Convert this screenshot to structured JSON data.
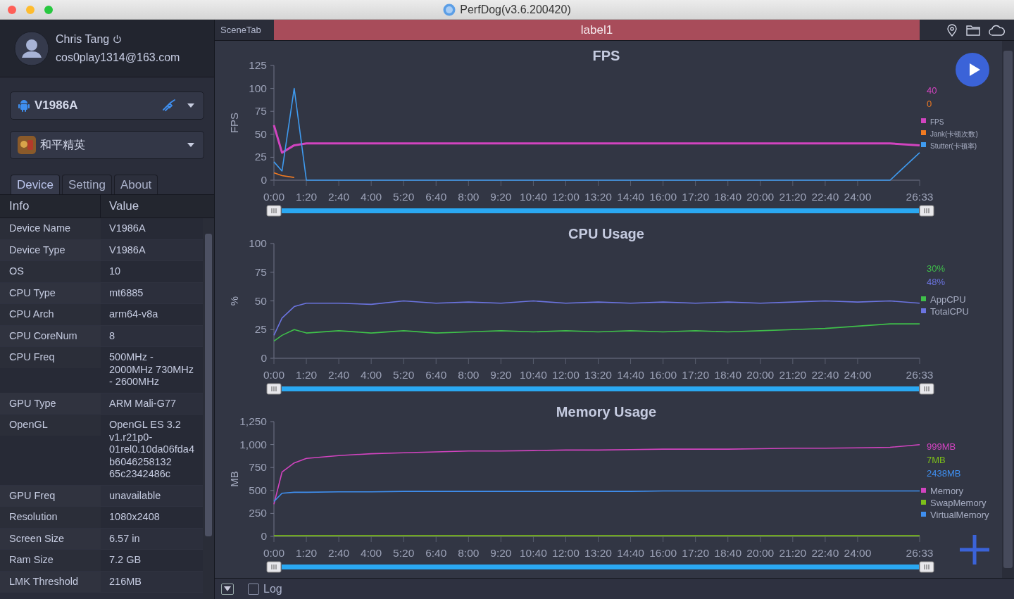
{
  "window": {
    "title": "PerfDog(v3.6.200420)"
  },
  "user": {
    "name": "Chris Tang",
    "email": "cos0play1314@163.com"
  },
  "device_select": {
    "value": "V1986A"
  },
  "app_select": {
    "value": "和平精英"
  },
  "tabs": [
    {
      "label": "Device",
      "selected": true
    },
    {
      "label": "Setting",
      "selected": false
    },
    {
      "label": "About",
      "selected": false
    }
  ],
  "info_table": {
    "columns": [
      "Info",
      "Value"
    ],
    "rows": [
      {
        "label": "Device Name",
        "value": "V1986A"
      },
      {
        "label": "Device Type",
        "value": "V1986A"
      },
      {
        "label": "OS",
        "value": "10"
      },
      {
        "label": "CPU Type",
        "value": "mt6885"
      },
      {
        "label": "CPU Arch",
        "value": "arm64-v8a"
      },
      {
        "label": "CPU CoreNum",
        "value": "8"
      },
      {
        "label": "CPU Freq",
        "value": "500MHz - 2000MHz 730MHz - 2600MHz"
      },
      {
        "label": "GPU Type",
        "value": "ARM Mali-G77"
      },
      {
        "label": "OpenGL",
        "value": "OpenGL ES 3.2 v1.r21p0-01rel0.10da06fda4b6046258132 65c2342486c"
      },
      {
        "label": "GPU Freq",
        "value": "unavailable"
      },
      {
        "label": "Resolution",
        "value": "1080x2408"
      },
      {
        "label": "Screen Size",
        "value": "6.57 in"
      },
      {
        "label": "Ram Size",
        "value": "7.2 GB"
      },
      {
        "label": "LMK Threshold",
        "value": "216MB"
      }
    ]
  },
  "scene_tab": {
    "label": "SceneTab",
    "scene": "label1"
  },
  "charts": [
    {
      "readings": [
        {
          "text": "40",
          "color": "#d244c0"
        },
        {
          "text": "0",
          "color": "#f07a22"
        }
      ],
      "chart_data": {
        "type": "line",
        "title": "FPS",
        "ylabel": "FPS",
        "x": [
          0,
          20,
          50,
          80,
          160,
          240,
          320,
          400,
          480,
          560,
          640,
          720,
          800,
          880,
          960,
          1040,
          1120,
          1200,
          1280,
          1360,
          1440,
          1520,
          1593
        ],
        "series": [
          {
            "name": "FPS",
            "color": "#d244c0",
            "values": [
              60,
              30,
              38,
              40,
              40,
              40,
              40,
              40,
              40,
              40,
              40,
              40,
              40,
              40,
              40,
              40,
              40,
              40,
              40,
              40,
              40,
              40,
              38
            ]
          },
          {
            "name": "Jank(卡顿次数)",
            "color": "#f07a22",
            "values": [
              8,
              5,
              3,
              null,
              null,
              null,
              null,
              null,
              null,
              null,
              null,
              null,
              null,
              null,
              null,
              null,
              null,
              null,
              null,
              null,
              null,
              null,
              null
            ]
          },
          {
            "name": "Stutter(卡顿率)",
            "color": "#3f9bf0",
            "values": [
              20,
              10,
              100,
              0,
              0,
              0,
              0,
              0,
              0,
              0,
              0,
              0,
              0,
              0,
              0,
              0,
              0,
              0,
              0,
              0,
              0,
              0,
              30
            ]
          }
        ],
        "legend": true,
        "xlim": [
          0,
          1593
        ],
        "ylim": [
          0,
          125
        ],
        "xticks": [
          {
            "value": 0,
            "label": "0:00"
          },
          {
            "value": 80,
            "label": "1:20"
          },
          {
            "value": 160,
            "label": "2:40"
          },
          {
            "value": 240,
            "label": "4:00"
          },
          {
            "value": 320,
            "label": "5:20"
          },
          {
            "value": 400,
            "label": "6:40"
          },
          {
            "value": 480,
            "label": "8:00"
          },
          {
            "value": 560,
            "label": "9:20"
          },
          {
            "value": 640,
            "label": "10:40"
          },
          {
            "value": 720,
            "label": "12:00"
          },
          {
            "value": 800,
            "label": "13:20"
          },
          {
            "value": 880,
            "label": "14:40"
          },
          {
            "value": 960,
            "label": "16:00"
          },
          {
            "value": 1040,
            "label": "17:20"
          },
          {
            "value": 1120,
            "label": "18:40"
          },
          {
            "value": 1200,
            "label": "20:00"
          },
          {
            "value": 1280,
            "label": "21:20"
          },
          {
            "value": 1360,
            "label": "22:40"
          },
          {
            "value": 1440,
            "label": "24:00"
          },
          {
            "value": 1593,
            "label": "26:33"
          }
        ],
        "yticks": [
          0,
          25,
          50,
          75,
          100,
          125
        ]
      }
    },
    {
      "readings": [
        {
          "text": "30%",
          "color": "#3fbf4a"
        },
        {
          "text": "48%",
          "color": "#6b74e0"
        }
      ],
      "chart_data": {
        "type": "line",
        "title": "CPU Usage",
        "ylabel": "%",
        "x": [
          0,
          20,
          50,
          80,
          160,
          240,
          320,
          400,
          480,
          560,
          640,
          720,
          800,
          880,
          960,
          1040,
          1120,
          1200,
          1280,
          1360,
          1440,
          1520,
          1593
        ],
        "series": [
          {
            "name": "AppCPU",
            "color": "#3fbf4a",
            "values": [
              15,
              20,
              25,
              22,
              24,
              22,
              24,
              22,
              23,
              24,
              23,
              24,
              23,
              24,
              23,
              24,
              23,
              24,
              25,
              26,
              28,
              30,
              30
            ]
          },
          {
            "name": "TotalCPU",
            "color": "#6b74e0",
            "values": [
              20,
              35,
              45,
              48,
              48,
              47,
              50,
              48,
              49,
              48,
              50,
              48,
              49,
              48,
              49,
              48,
              49,
              48,
              49,
              50,
              49,
              50,
              48
            ]
          }
        ],
        "legend": true,
        "xlim": [
          0,
          1593
        ],
        "ylim": [
          0,
          100
        ],
        "xticks": [
          {
            "value": 0,
            "label": "0:00"
          },
          {
            "value": 80,
            "label": "1:20"
          },
          {
            "value": 160,
            "label": "2:40"
          },
          {
            "value": 240,
            "label": "4:00"
          },
          {
            "value": 320,
            "label": "5:20"
          },
          {
            "value": 400,
            "label": "6:40"
          },
          {
            "value": 480,
            "label": "8:00"
          },
          {
            "value": 560,
            "label": "9:20"
          },
          {
            "value": 640,
            "label": "10:40"
          },
          {
            "value": 720,
            "label": "12:00"
          },
          {
            "value": 800,
            "label": "13:20"
          },
          {
            "value": 880,
            "label": "14:40"
          },
          {
            "value": 960,
            "label": "16:00"
          },
          {
            "value": 1040,
            "label": "17:20"
          },
          {
            "value": 1120,
            "label": "18:40"
          },
          {
            "value": 1200,
            "label": "20:00"
          },
          {
            "value": 1280,
            "label": "21:20"
          },
          {
            "value": 1360,
            "label": "22:40"
          },
          {
            "value": 1440,
            "label": "24:00"
          },
          {
            "value": 1593,
            "label": "26:33"
          }
        ],
        "yticks": [
          0,
          25,
          50,
          75,
          100
        ]
      }
    },
    {
      "readings": [
        {
          "text": "999MB",
          "color": "#d244c0"
        },
        {
          "text": "7MB",
          "color": "#7dbf1a"
        },
        {
          "text": "2438MB",
          "color": "#3f8ff0"
        }
      ],
      "chart_data": {
        "type": "line",
        "title": "Memory Usage",
        "ylabel": "MB",
        "x": [
          0,
          20,
          50,
          80,
          160,
          240,
          320,
          400,
          480,
          560,
          640,
          720,
          800,
          880,
          960,
          1040,
          1120,
          1200,
          1280,
          1360,
          1440,
          1520,
          1593
        ],
        "series": [
          {
            "name": "Memory",
            "color": "#d244c0",
            "values": [
              350,
              700,
              800,
              850,
              880,
              900,
              910,
              920,
              930,
              930,
              935,
              940,
              940,
              945,
              950,
              950,
              950,
              955,
              960,
              960,
              965,
              970,
              999
            ]
          },
          {
            "name": "SwapMemory",
            "color": "#7dbf1a",
            "values": [
              7,
              7,
              7,
              7,
              7,
              7,
              7,
              7,
              7,
              7,
              7,
              7,
              7,
              7,
              7,
              7,
              7,
              7,
              7,
              7,
              7,
              7,
              7
            ]
          },
          {
            "name": "VirtualMemory",
            "color": "#3f8ff0",
            "values": [
              380,
              470,
              480,
              480,
              485,
              485,
              490,
              490,
              490,
              490,
              490,
              490,
              490,
              490,
              495,
              495,
              495,
              495,
              495,
              495,
              495,
              495,
              495
            ]
          }
        ],
        "legend": true,
        "xlim": [
          0,
          1593
        ],
        "ylim": [
          0,
          1250
        ],
        "xticks": [
          {
            "value": 0,
            "label": "0:00"
          },
          {
            "value": 80,
            "label": "1:20"
          },
          {
            "value": 160,
            "label": "2:40"
          },
          {
            "value": 240,
            "label": "4:00"
          },
          {
            "value": 320,
            "label": "5:20"
          },
          {
            "value": 400,
            "label": "6:40"
          },
          {
            "value": 480,
            "label": "8:00"
          },
          {
            "value": 560,
            "label": "9:20"
          },
          {
            "value": 640,
            "label": "10:40"
          },
          {
            "value": 720,
            "label": "12:00"
          },
          {
            "value": 800,
            "label": "13:20"
          },
          {
            "value": 880,
            "label": "14:40"
          },
          {
            "value": 960,
            "label": "16:00"
          },
          {
            "value": 1040,
            "label": "17:20"
          },
          {
            "value": 1120,
            "label": "18:40"
          },
          {
            "value": 1200,
            "label": "20:00"
          },
          {
            "value": 1280,
            "label": "21:20"
          },
          {
            "value": 1360,
            "label": "22:40"
          },
          {
            "value": 1440,
            "label": "24:00"
          },
          {
            "value": 1593,
            "label": "26:33"
          }
        ],
        "yticks": [
          0,
          {
            "value": 250,
            "label": "250"
          },
          {
            "value": 500,
            "label": "500"
          },
          {
            "value": 750,
            "label": "750"
          },
          {
            "value": 1000,
            "label": "1,000"
          },
          {
            "value": 1250,
            "label": "1,250"
          }
        ]
      }
    }
  ],
  "log": {
    "label": "Log",
    "checked": false
  }
}
